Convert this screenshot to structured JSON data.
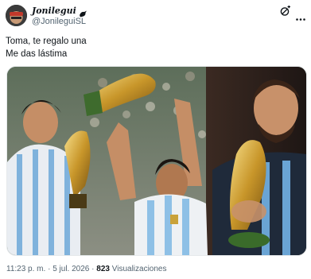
{
  "post": {
    "display_name": "Jonilegui",
    "handle": "@JonileguiSL",
    "text_line1": "Toma, te regalo una",
    "text_line2": "Me das lástima",
    "time": "11:23 p. m.",
    "separator1": "·",
    "date": "5 jul. 2026",
    "separator2": "·",
    "views_count": "823",
    "views_label": "Visualizaciones"
  },
  "icons": {
    "bird": "bird-icon",
    "follow": "follow-icon",
    "more": "more-icon"
  }
}
